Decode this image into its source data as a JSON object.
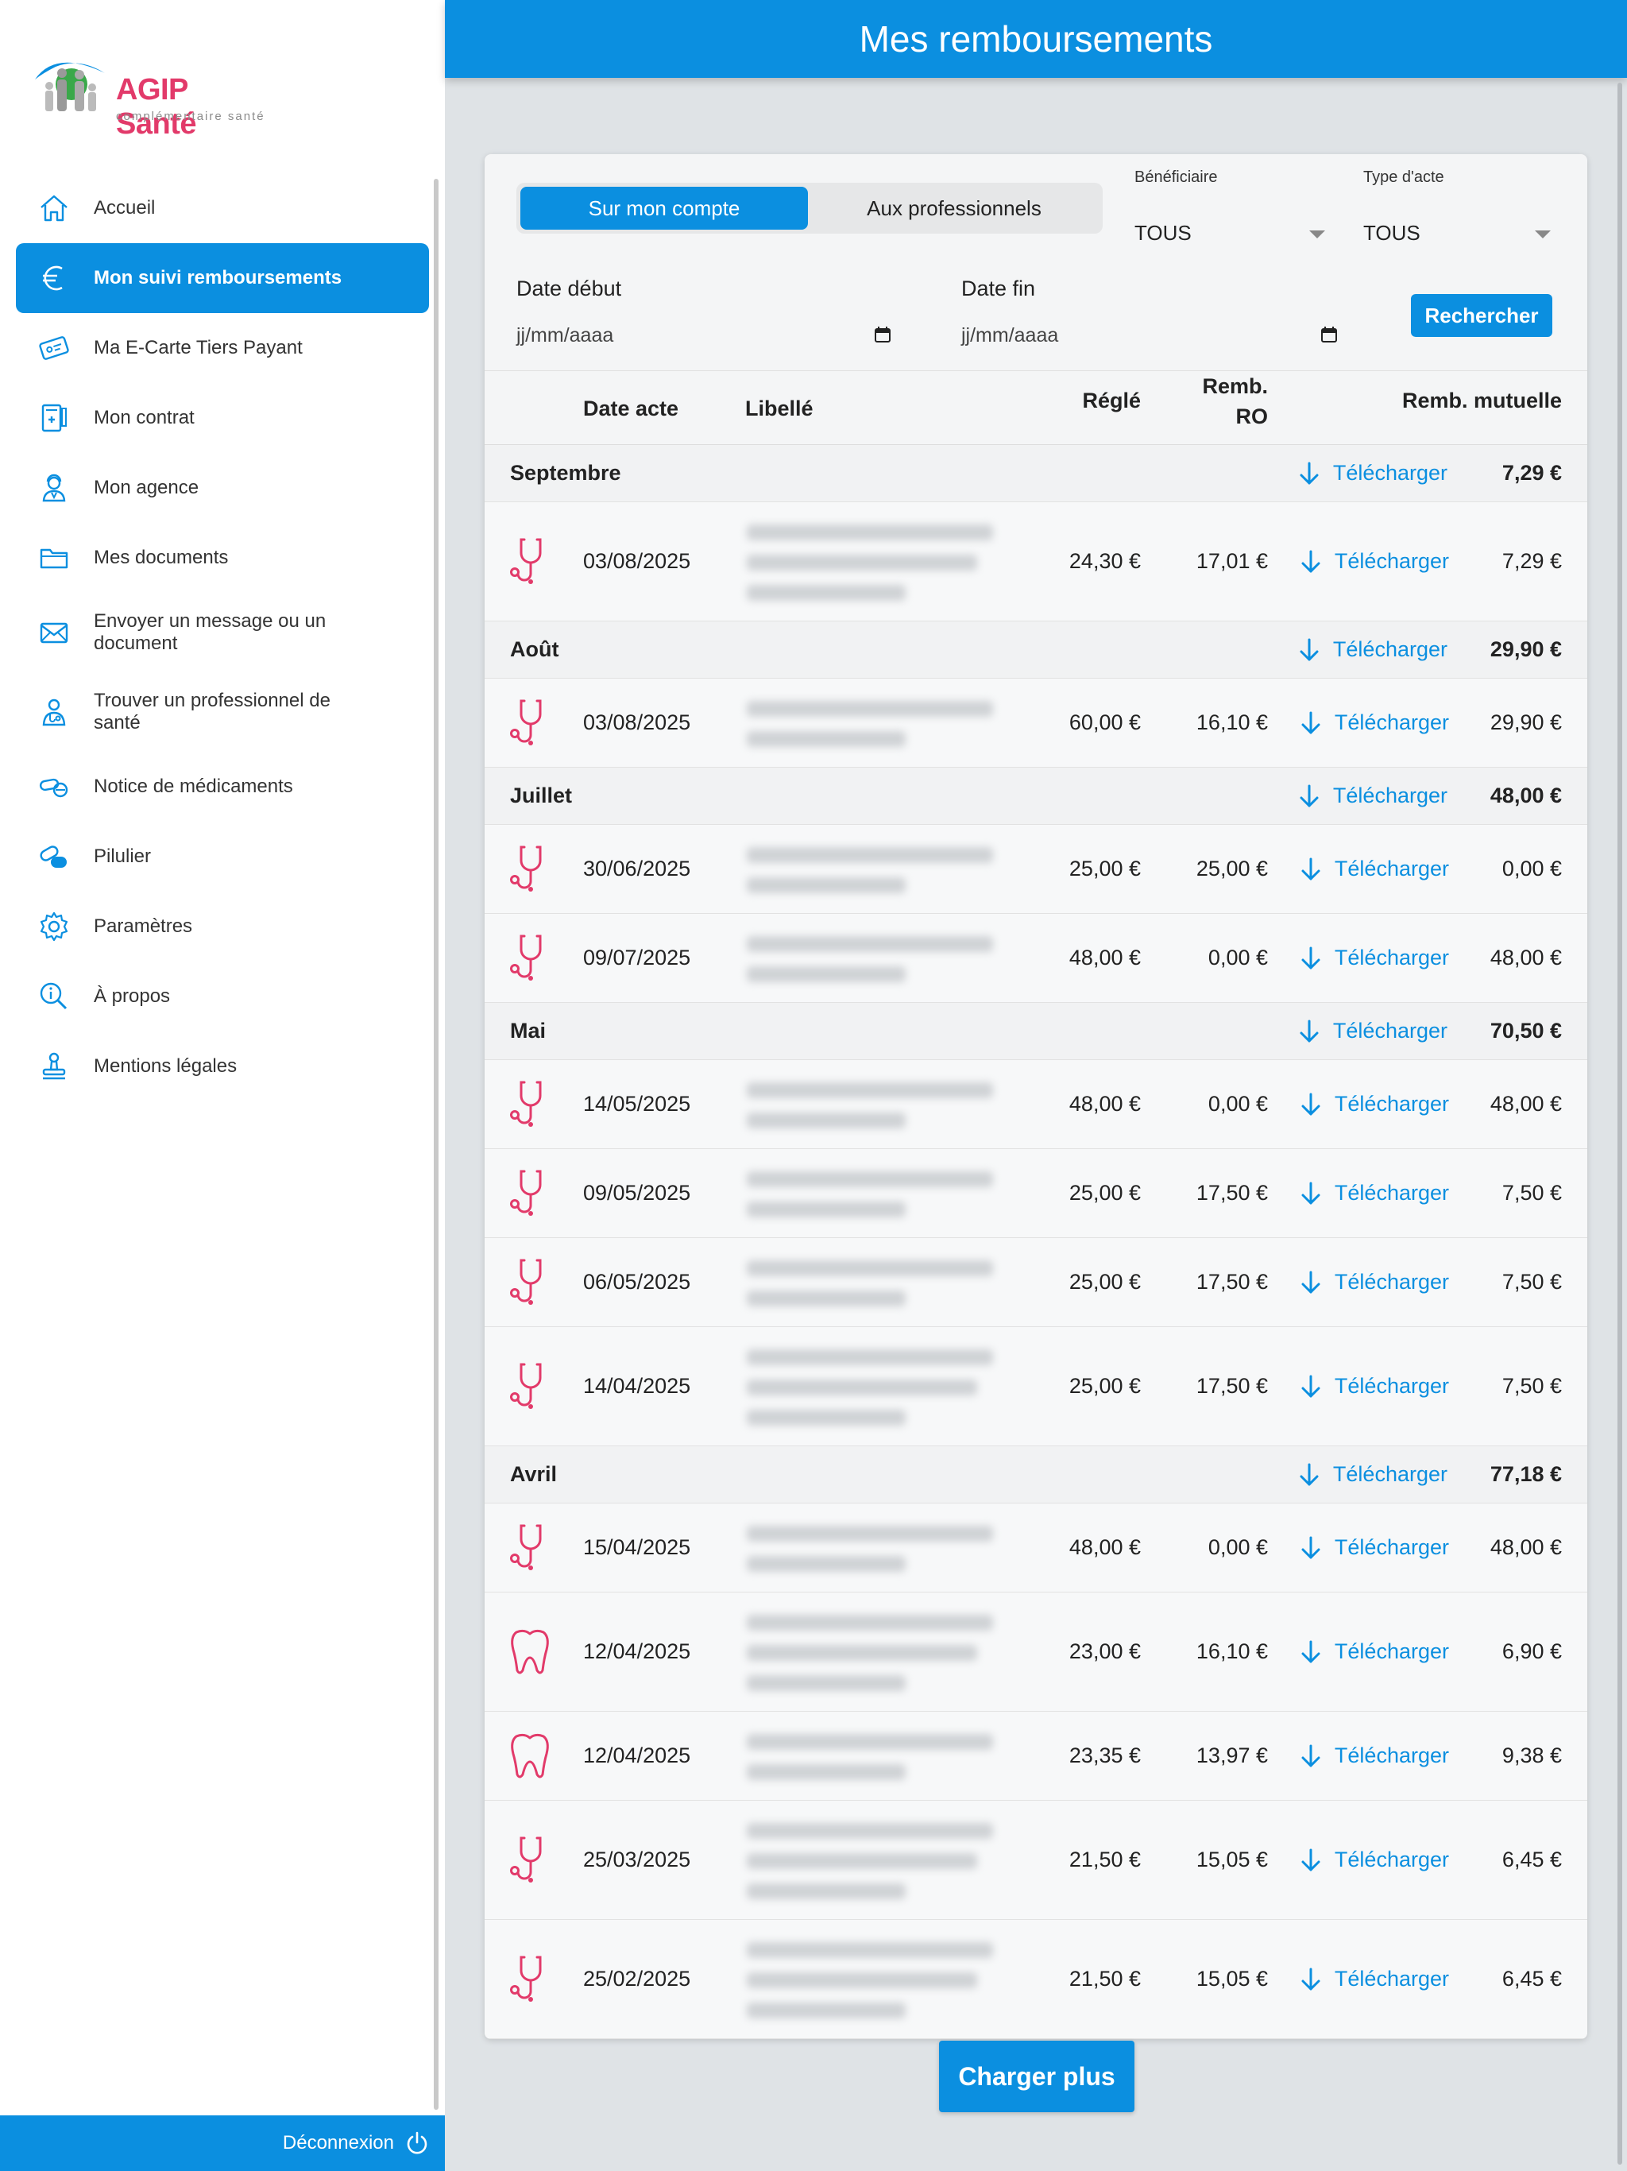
{
  "header": {
    "title": "Mes remboursements"
  },
  "brand": {
    "name": "AGIP",
    "name2": "Santé",
    "tagline": "complémentaire santé"
  },
  "sidebar": {
    "items": [
      {
        "label": "Accueil",
        "icon": "home-icon"
      },
      {
        "label": "Mon suivi remboursements",
        "icon": "euro-icon",
        "active": true
      },
      {
        "label": "Ma E-Carte Tiers Payant",
        "icon": "card-icon"
      },
      {
        "label": "Mon contrat",
        "icon": "contract-icon"
      },
      {
        "label": "Mon agence",
        "icon": "agent-icon"
      },
      {
        "label": "Mes documents",
        "icon": "folder-icon"
      },
      {
        "label": "Envoyer un message ou un document",
        "icon": "envelope-icon"
      },
      {
        "label": "Trouver un professionnel de santé",
        "icon": "doctor-icon"
      },
      {
        "label": "Notice de médicaments",
        "icon": "pills-icon"
      },
      {
        "label": "Pilulier",
        "icon": "pillbox-icon"
      },
      {
        "label": "Paramètres",
        "icon": "gear-icon"
      },
      {
        "label": "À propos",
        "icon": "info-icon"
      },
      {
        "label": "Mentions légales",
        "icon": "stamp-icon"
      }
    ],
    "logout_label": "Déconnexion"
  },
  "filters": {
    "tab_account": "Sur mon compte",
    "tab_pros": "Aux professionnels",
    "beneficiary_label": "Bénéficiaire",
    "beneficiary_value": "TOUS",
    "act_type_label": "Type d'acte",
    "act_type_value": "TOUS",
    "date_start_label": "Date début",
    "date_start_placeholder": "jj/mm/aaaa",
    "date_end_label": "Date fin",
    "date_end_placeholder": "jj/mm/aaaa",
    "search_label": "Rechercher"
  },
  "table": {
    "headers": {
      "date": "Date acte",
      "label": "Libellé",
      "paid": "Réglé",
      "ro_1": "Remb.",
      "ro_2": "RO",
      "mutual": "Remb. mutuelle"
    },
    "download_label": "Télécharger",
    "groups": [
      {
        "name": "Septembre",
        "total": "7,29 €",
        "rows": [
          {
            "icon": "stethoscope-icon",
            "date": "03/08/2025",
            "paid": "24,30 €",
            "ro": "17,01 €",
            "mutual": "7,29 €",
            "lines": 3
          }
        ]
      },
      {
        "name": "Août",
        "total": "29,90 €",
        "rows": [
          {
            "icon": "stethoscope-icon",
            "date": "03/08/2025",
            "paid": "60,00 €",
            "ro": "16,10 €",
            "mutual": "29,90 €",
            "lines": 2
          }
        ]
      },
      {
        "name": "Juillet",
        "total": "48,00 €",
        "rows": [
          {
            "icon": "stethoscope-icon",
            "date": "30/06/2025",
            "paid": "25,00 €",
            "ro": "25,00 €",
            "mutual": "0,00 €",
            "lines": 2
          },
          {
            "icon": "stethoscope-icon",
            "date": "09/07/2025",
            "paid": "48,00 €",
            "ro": "0,00 €",
            "mutual": "48,00 €",
            "lines": 2
          }
        ]
      },
      {
        "name": "Mai",
        "total": "70,50 €",
        "rows": [
          {
            "icon": "stethoscope-icon",
            "date": "14/05/2025",
            "paid": "48,00 €",
            "ro": "0,00 €",
            "mutual": "48,00 €",
            "lines": 2
          },
          {
            "icon": "stethoscope-icon",
            "date": "09/05/2025",
            "paid": "25,00 €",
            "ro": "17,50 €",
            "mutual": "7,50 €",
            "lines": 2
          },
          {
            "icon": "stethoscope-icon",
            "date": "06/05/2025",
            "paid": "25,00 €",
            "ro": "17,50 €",
            "mutual": "7,50 €",
            "lines": 2
          },
          {
            "icon": "stethoscope-icon",
            "date": "14/04/2025",
            "paid": "25,00 €",
            "ro": "17,50 €",
            "mutual": "7,50 €",
            "lines": 3
          }
        ]
      },
      {
        "name": "Avril",
        "total": "77,18 €",
        "rows": [
          {
            "icon": "stethoscope-icon",
            "date": "15/04/2025",
            "paid": "48,00 €",
            "ro": "0,00 €",
            "mutual": "48,00 €",
            "lines": 2
          },
          {
            "icon": "tooth-icon",
            "date": "12/04/2025",
            "paid": "23,00 €",
            "ro": "16,10 €",
            "mutual": "6,90 €",
            "lines": 3
          },
          {
            "icon": "tooth-icon",
            "date": "12/04/2025",
            "paid": "23,35 €",
            "ro": "13,97 €",
            "mutual": "9,38 €",
            "lines": 2
          },
          {
            "icon": "stethoscope-icon",
            "date": "25/03/2025",
            "paid": "21,50 €",
            "ro": "15,05 €",
            "mutual": "6,45 €",
            "lines": 3
          },
          {
            "icon": "stethoscope-icon",
            "date": "25/02/2025",
            "paid": "21,50 €",
            "ro": "15,05 €",
            "mutual": "6,45 €",
            "lines": 3
          }
        ]
      }
    ]
  },
  "load_more_label": "Charger plus",
  "colors": {
    "primary": "#0b8fe0",
    "accent": "#e23a6a"
  }
}
